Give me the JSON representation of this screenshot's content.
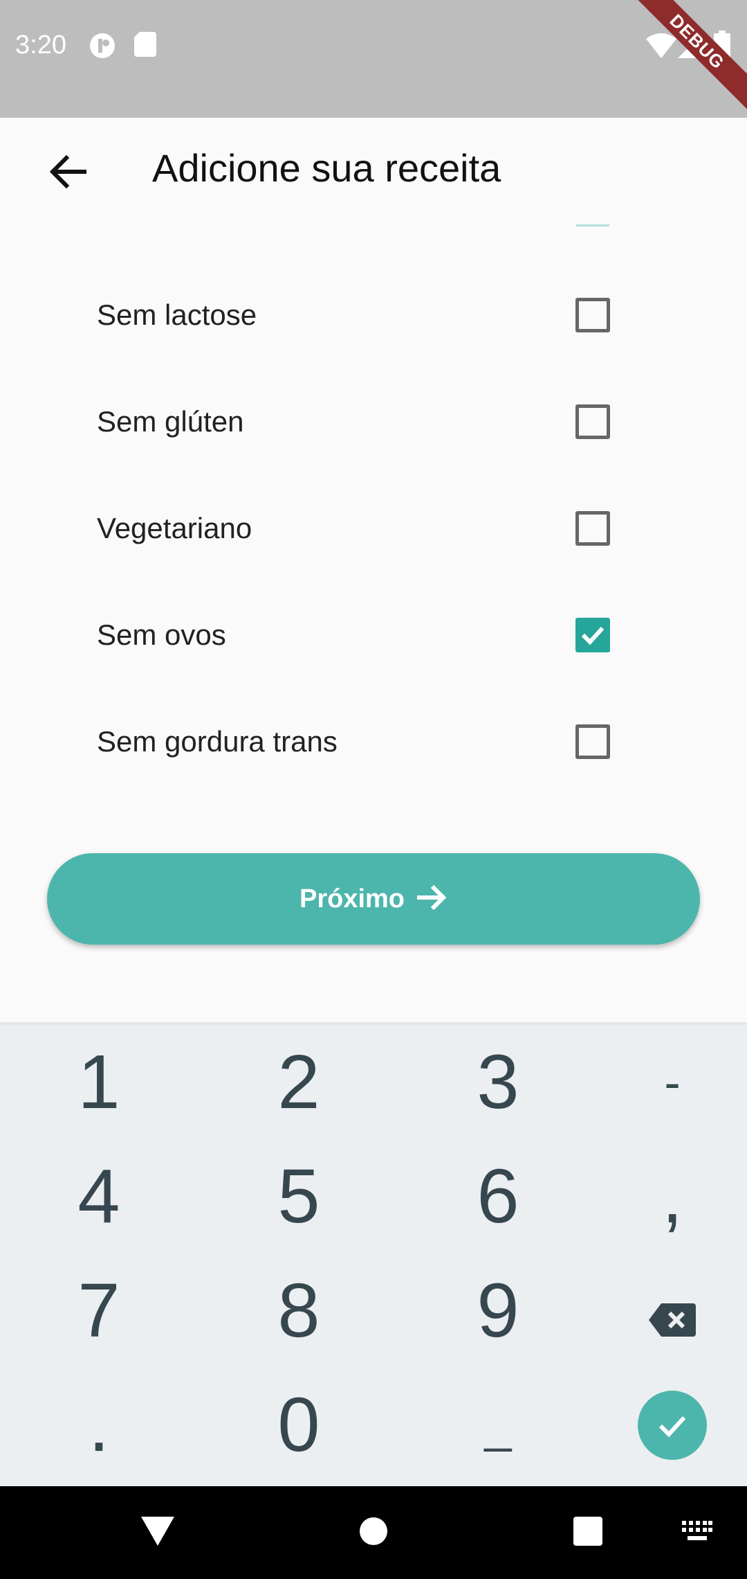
{
  "status_bar": {
    "time": "3:20",
    "debug_label": "DEBUG",
    "icons": [
      "notification-circle-icon",
      "sd-card-icon",
      "wifi-icon",
      "cell-signal-icon",
      "battery-icon"
    ]
  },
  "app_bar": {
    "title": "Adicione sua receita",
    "back_icon": "arrow-left-icon"
  },
  "options": [
    {
      "label": "Sem lactose",
      "checked": false
    },
    {
      "label": "Sem glúten",
      "checked": false
    },
    {
      "label": "Vegetariano",
      "checked": false
    },
    {
      "label": "Sem ovos",
      "checked": true
    },
    {
      "label": "Sem gordura trans",
      "checked": false
    }
  ],
  "next_button": {
    "label": "Próximo",
    "icon": "arrow-right-icon",
    "color": "#4DB6AC"
  },
  "keyboard": {
    "rows": [
      [
        "1",
        "2",
        "3",
        "-"
      ],
      [
        "4",
        "5",
        "6",
        ","
      ],
      [
        "7",
        "8",
        "9",
        "⌫"
      ],
      [
        ".",
        "0",
        "_",
        "✓"
      ]
    ]
  },
  "nav_bar": {
    "icons": [
      "back-triangle-icon",
      "home-circle-icon",
      "recents-square-icon",
      "keyboard-icon"
    ]
  },
  "colors": {
    "accent": "#26A69A",
    "button": "#4DB6AC",
    "keyboard_bg": "#ECEFF1",
    "key_text": "#37474F"
  }
}
